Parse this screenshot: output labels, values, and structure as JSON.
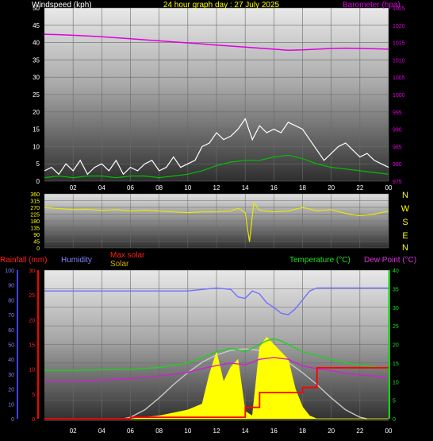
{
  "header": {
    "left_label": "Windspeed (kph)",
    "title": "24 hour graph day : 27 July 2025",
    "right_label": "Barometer (hpa)"
  },
  "wind_dir_labels": [
    "N",
    "W",
    "S",
    "E",
    "N"
  ],
  "legend": {
    "rainfall": "Rainfall (mm)",
    "humidity": "Humidity",
    "max_solar": "Max solar",
    "solar": "Solar",
    "temperature": "Temperature (°C)",
    "dew_point": "Dew Point (°C)"
  },
  "colors": {
    "windspeed": "#ffffff",
    "wind_avg": "#00c000",
    "barometer": "#e000e0",
    "wind_dir": "#e8e800",
    "rainfall": "#ff0000",
    "humidity": "#7070ff",
    "max_solar": "#c8c8c8",
    "solar": "#ffff00",
    "temperature": "#20d020",
    "dew_point": "#d020d0"
  },
  "chart_data": [
    {
      "type": "line",
      "title": "24 hour graph day : 27 July 2025",
      "x_ticks": [
        "02",
        "04",
        "06",
        "08",
        "10",
        "12",
        "14",
        "16",
        "18",
        "20",
        "22",
        "00"
      ],
      "x_range": [
        0,
        24
      ],
      "y_left": {
        "label": "Windspeed (kph)",
        "range": [
          0,
          50
        ],
        "ticks": [
          0,
          5,
          10,
          15,
          20,
          25,
          30,
          35,
          40,
          45,
          50
        ]
      },
      "y_right": {
        "label": "Barometer (hpa)",
        "range": [
          975,
          1025
        ],
        "ticks": [
          975,
          980,
          985,
          990,
          995,
          1000,
          1005,
          1010,
          1015,
          1020,
          1025
        ]
      },
      "series": [
        {
          "name": "Windspeed (kph)",
          "axis": "left",
          "x": [
            0,
            0.5,
            1,
            1.5,
            2,
            2.5,
            3,
            3.5,
            4,
            4.5,
            5,
            5.5,
            6,
            6.5,
            7,
            7.5,
            8,
            8.5,
            9,
            9.5,
            10,
            10.5,
            11,
            11.5,
            12,
            12.5,
            13,
            13.5,
            14,
            14.5,
            15,
            15.5,
            16,
            16.5,
            17,
            17.5,
            18,
            18.5,
            19,
            19.5,
            20,
            20.5,
            21,
            21.5,
            22,
            22.5,
            23,
            23.5,
            24
          ],
          "y": [
            3,
            4,
            2,
            5,
            3,
            6,
            2,
            4,
            5,
            3,
            6,
            2,
            4,
            3,
            5,
            6,
            3,
            4,
            7,
            4,
            5,
            6,
            10,
            11,
            14,
            12,
            13,
            15,
            18,
            12,
            16,
            14,
            15,
            14,
            17,
            16,
            15,
            12,
            9,
            6,
            8,
            10,
            11,
            9,
            7,
            8,
            6,
            5,
            4
          ]
        },
        {
          "name": "Average windspeed",
          "axis": "left",
          "x": [
            0,
            1,
            2,
            3,
            4,
            5,
            6,
            7,
            8,
            9,
            10,
            11,
            12,
            13,
            14,
            15,
            16,
            17,
            18,
            19,
            20,
            21,
            22,
            23,
            24
          ],
          "y": [
            1,
            1.5,
            1,
            1.5,
            1.5,
            1,
            1.5,
            1.5,
            1,
            1.5,
            2,
            3,
            4.5,
            5.5,
            6,
            6,
            7,
            7.5,
            6.5,
            5,
            4,
            3.5,
            3,
            2.5,
            2
          ]
        },
        {
          "name": "Barometer (hpa)",
          "axis": "right",
          "x": [
            0,
            1,
            2,
            3,
            4,
            5,
            6,
            7,
            8,
            9,
            10,
            11,
            12,
            13,
            14,
            15,
            16,
            17,
            18,
            19,
            20,
            21,
            22,
            23,
            24
          ],
          "y": [
            1017.4,
            1017.3,
            1017.1,
            1016.9,
            1016.7,
            1016.4,
            1016.1,
            1015.8,
            1015.5,
            1015.2,
            1014.9,
            1014.6,
            1014.3,
            1014.0,
            1013.7,
            1013.4,
            1013.1,
            1012.8,
            1012.9,
            1013.1,
            1013.3,
            1013.4,
            1013.3,
            1013.2,
            1013.1
          ]
        }
      ]
    },
    {
      "type": "line",
      "title": "",
      "y_ticks": [
        0,
        45,
        90,
        135,
        180,
        225,
        270,
        315,
        360
      ],
      "y_range": [
        0,
        360
      ],
      "x_range": [
        0,
        24
      ],
      "series": [
        {
          "name": "Wind direction",
          "x": [
            0,
            1,
            2,
            3,
            4,
            5,
            6,
            7,
            8,
            9,
            10,
            11,
            12,
            13,
            13.5,
            14,
            14.3,
            14.6,
            15,
            16,
            17,
            18,
            19,
            20,
            21,
            22,
            23,
            24
          ],
          "y": [
            270,
            262,
            255,
            258,
            250,
            255,
            245,
            252,
            245,
            240,
            235,
            240,
            240,
            245,
            265,
            235,
            40,
            300,
            250,
            240,
            245,
            270,
            248,
            255,
            230,
            215,
            225,
            245
          ]
        }
      ]
    },
    {
      "type": "line",
      "title": "",
      "x_ticks": [
        "02",
        "04",
        "06",
        "08",
        "10",
        "12",
        "14",
        "16",
        "18",
        "20",
        "22",
        "00"
      ],
      "x_range": [
        0,
        24
      ],
      "y_humidity": {
        "label": "Humidity",
        "range": [
          0,
          100
        ],
        "ticks": [
          0,
          10,
          20,
          30,
          40,
          50,
          60,
          70,
          80,
          90,
          100
        ]
      },
      "y_rain": {
        "label": "Rainfall (mm)",
        "range": [
          0,
          30
        ],
        "ticks": [
          0,
          5,
          10,
          15,
          20,
          25,
          30
        ]
      },
      "y_temp": {
        "label": "Temperature (°C)",
        "range": [
          0,
          40
        ],
        "ticks": [
          0,
          5,
          10,
          15,
          20,
          25,
          30,
          35,
          40
        ]
      },
      "series": [
        {
          "name": "Humidity",
          "axis": "humidity",
          "x": [
            0,
            2,
            4,
            6,
            8,
            10,
            11,
            12,
            13,
            13.5,
            14,
            14.5,
            15,
            15.5,
            16,
            16.5,
            17,
            17.5,
            18,
            18.5,
            19,
            20,
            22,
            24
          ],
          "y": [
            86,
            86,
            86,
            86,
            86,
            86,
            87,
            88,
            87,
            82,
            81,
            86,
            84,
            78,
            75,
            71,
            70,
            74,
            80,
            86,
            88,
            88,
            88,
            88
          ]
        },
        {
          "name": "Rainfall (mm)",
          "axis": "rain",
          "x": [
            0,
            6,
            6.01,
            14,
            14.01,
            15,
            15.01,
            18,
            18.01,
            19,
            19.01,
            24
          ],
          "y": [
            0,
            0,
            0.3,
            0.3,
            2.3,
            2.3,
            5.3,
            5.3,
            6.3,
            6.3,
            10.3,
            10.3
          ]
        },
        {
          "name": "Max solar",
          "axis": "humidity",
          "x": [
            5.5,
            6,
            7,
            8,
            9,
            10,
            11,
            12,
            13,
            14,
            15,
            16,
            17,
            18,
            19,
            20,
            21,
            22,
            22.5
          ],
          "y": [
            0,
            1,
            6,
            14,
            23,
            31,
            38,
            43,
            46,
            47,
            46,
            43,
            38,
            31,
            23,
            14,
            6,
            1,
            0
          ]
        },
        {
          "name": "Solar",
          "axis": "humidity",
          "x": [
            0,
            6,
            7,
            8,
            9,
            10,
            11,
            11.5,
            12,
            12.5,
            13,
            13.5,
            14,
            14.5,
            15,
            15.5,
            16,
            16.5,
            17,
            17.5,
            18,
            18.5,
            19,
            24
          ],
          "y": [
            0,
            0,
            1,
            2,
            4,
            6,
            10,
            30,
            45,
            25,
            35,
            40,
            5,
            2,
            48,
            55,
            50,
            45,
            40,
            20,
            8,
            2,
            0,
            0
          ]
        },
        {
          "name": "Temperature (°C)",
          "axis": "temp",
          "x": [
            0,
            2,
            4,
            6,
            8,
            10,
            11,
            12,
            13,
            14,
            15,
            15.5,
            16,
            16.5,
            17,
            18,
            19,
            20,
            21,
            22,
            23,
            24
          ],
          "y": [
            13,
            13,
            13.2,
            13.3,
            13.8,
            15,
            16.5,
            18,
            19,
            18,
            20,
            21,
            21.5,
            21,
            20,
            18,
            17,
            16,
            15,
            14.5,
            14,
            13.5
          ]
        },
        {
          "name": "Dew Point (°C)",
          "axis": "temp",
          "x": [
            0,
            2,
            4,
            6,
            8,
            10,
            11,
            12,
            13,
            14,
            15,
            16,
            17,
            18,
            19,
            20,
            21,
            22,
            23,
            24
          ],
          "y": [
            10,
            10.2,
            10.4,
            10.8,
            11.5,
            12.5,
            13.5,
            14.3,
            15,
            14.5,
            16,
            16.5,
            16,
            14.2,
            13.5,
            13,
            12.2,
            11.8,
            11.5,
            11
          ]
        }
      ]
    }
  ]
}
